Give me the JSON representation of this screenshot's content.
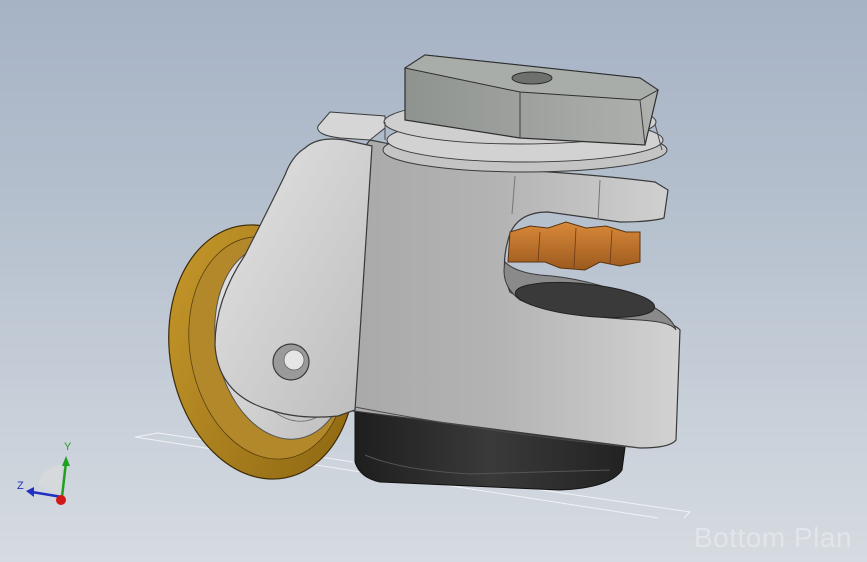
{
  "viewport": {
    "background_top": "#a6b3c5",
    "background_bottom": "#d6dbe1"
  },
  "model": {
    "body_color": "#c2c2c2",
    "knob_color": "#a5a8a5",
    "wheel_tire_color": "#b88a1e",
    "wheel_hub_color": "#c9c9c9",
    "nut_color": "#c7772b",
    "base_color": "#2c2c2c",
    "edge_color": "#3a3a3a"
  },
  "triad": {
    "y_label": "Y",
    "z_label": "Z",
    "x_color": "#d01818",
    "y_color": "#20a020",
    "z_color": "#2030c0"
  },
  "plane": {
    "name": "Bottom Plan"
  }
}
